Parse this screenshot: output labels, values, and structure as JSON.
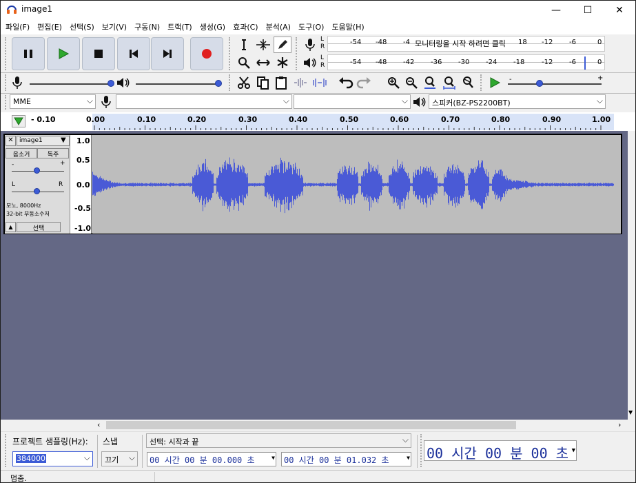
{
  "window": {
    "title": "image1",
    "minimize": "—",
    "maximize": "☐",
    "close": "✕"
  },
  "menu": [
    "파일(F)",
    "편집(E)",
    "선택(S)",
    "보기(V)",
    "구동(N)",
    "트랙(T)",
    "생성(G)",
    "효과(C)",
    "분석(A)",
    "도구(O)",
    "도움말(H)"
  ],
  "meters": {
    "record": {
      "L": "L",
      "R": "R",
      "ticks": [
        "-54",
        "-48",
        "-4"
      ],
      "prompt": "모니터링을 시작 하려면 클릭",
      "ticks2": [
        "18",
        "-12",
        "-6",
        "0"
      ]
    },
    "play": {
      "L": "L",
      "R": "R",
      "ticks": [
        "-54",
        "-48",
        "-42",
        "-36",
        "-30",
        "-24",
        "-18",
        "-12",
        "-6",
        "0"
      ]
    }
  },
  "devices": {
    "host": "MME",
    "record_device": "",
    "channels": "",
    "playback_device": "스피커(BZ-PS2200BT)"
  },
  "ruler": {
    "ticks": [
      "- 0.10",
      "0.00",
      "0.10",
      "0.20",
      "0.30",
      "0.40",
      "0.50",
      "0.60",
      "0.70",
      "0.80",
      "0.90",
      "1.00"
    ]
  },
  "track": {
    "name": "image1",
    "mute": "음소거",
    "solo": "독주",
    "gain_minus": "-",
    "gain_plus": "+",
    "pan_left": "L",
    "pan_right": "R",
    "info_line1": "모노, 8000Hz",
    "info_line2": "32-bit 부동소수저",
    "select": "선택",
    "scale": [
      "1.0",
      "0.5",
      "0.0",
      "-0.5",
      "-1.0"
    ]
  },
  "selection_toolbar": {
    "rate_label": "프로젝트 샘플링(Hz):",
    "rate_value": "384000",
    "snap_label": "스냅",
    "snap_value": "끄기",
    "sel_mode": "선택: 시작과 끝",
    "start_time": "00 시간 00 분 00.000 초",
    "end_time": "00 시간 00 분 01.032 초",
    "big_time": "00 시간 00 분 00 초"
  },
  "status": "멈춤.",
  "colors": {
    "accent": "#3c5bd6",
    "waveform": "#4a5ad6",
    "track_bg": "#646885",
    "record_red": "#e02020",
    "play_green": "#2ea82e"
  }
}
